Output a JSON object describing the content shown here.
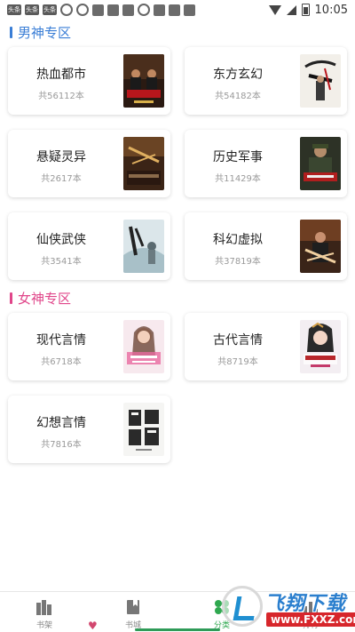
{
  "status_bar": {
    "time": "10:05",
    "left_icons": [
      "头条",
      "头条",
      "头条",
      "gear-icon",
      "settings-icon",
      "app-icon",
      "app-icon",
      "app-icon",
      "notification-icon",
      "app-icon",
      "app-icon",
      "a-icon"
    ]
  },
  "sections": {
    "male": {
      "title": "男神专区",
      "color": "#3a7ed6"
    },
    "female": {
      "title": "女神专区",
      "color": "#e0468a"
    }
  },
  "male_categories": [
    {
      "name": "热血都市",
      "count": "共56112本"
    },
    {
      "name": "东方玄幻",
      "count": "共54182本"
    },
    {
      "name": "悬疑灵异",
      "count": "共2617本"
    },
    {
      "name": "历史军事",
      "count": "共11429本"
    },
    {
      "name": "仙侠武侠",
      "count": "共3541本"
    },
    {
      "name": "科幻虚拟",
      "count": "共37819本"
    }
  ],
  "female_categories": [
    {
      "name": "现代言情",
      "count": "共6718本"
    },
    {
      "name": "古代言情",
      "count": "共8719本"
    },
    {
      "name": "幻想言情",
      "count": "共7816本"
    }
  ],
  "bottom_nav": {
    "items": [
      {
        "label": "书架",
        "icon": "bookshelf-icon"
      },
      {
        "label": "书城",
        "icon": "bookstore-icon"
      },
      {
        "label": "分类",
        "icon": "category-icon"
      },
      {
        "label": "排行",
        "icon": "ranking-icon"
      }
    ],
    "active_color": "#2fa84f"
  },
  "watermark": {
    "title": "飞翔下载",
    "url": "www.FXXZ.com"
  }
}
